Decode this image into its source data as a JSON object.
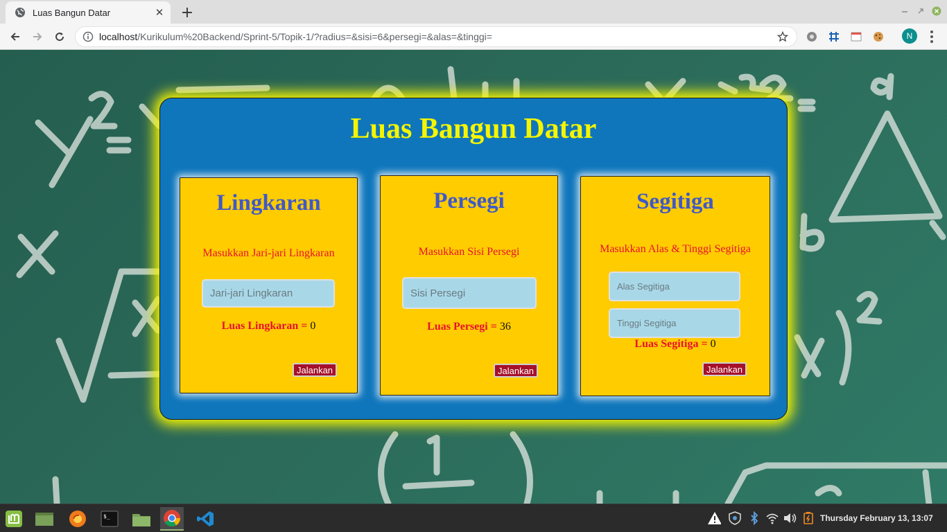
{
  "browser": {
    "tab_title": "Luas Bangun Datar",
    "tab_close": "✕",
    "new_tab": "+",
    "url_host": "localhost",
    "url_path": "/Kurikulum%20Backend/Sprint-5/Topik-1/?radius=&sisi=6&persegi=&alas=&tinggi=",
    "profile_initial": "N"
  },
  "page": {
    "title": "Luas Bangun Datar",
    "lingkaran": {
      "heading": "Lingkaran",
      "prompt": "Masukkan Jari-jari Lingkaran",
      "input_placeholder": "Jari-jari Lingkaran",
      "result_label": "Luas Lingkaran =",
      "result_value": "0",
      "button": "Jalankan"
    },
    "persegi": {
      "heading": "Persegi",
      "prompt": "Masukkan Sisi Persegi",
      "input_placeholder": "Sisi Persegi",
      "result_label": "Luas Persegi =",
      "result_value": "36",
      "button": "Jalankan"
    },
    "segitiga": {
      "heading": "Segitiga",
      "prompt": "Masukkan Alas & Tinggi Segitiga",
      "alas_placeholder": "Alas Segitiga",
      "tinggi_placeholder": "Tinggi Segitiga",
      "result_label": "Luas Segitiga =",
      "result_value": "0",
      "button": "Jalankan"
    }
  },
  "taskbar": {
    "clock": "Thursday February 13, 13:07",
    "apps": [
      "mint-menu-icon",
      "show-desktop-icon",
      "firefox-icon",
      "terminal-icon",
      "files-icon",
      "chrome-icon",
      "vscode-icon"
    ]
  },
  "colors": {
    "board": "#0f76bc",
    "board_glow": "#f5f500",
    "card": "#ffcc00",
    "heading": "#3f59c8",
    "prompt": "#e8112d",
    "button": "#a5102a",
    "input": "#a8d8e8"
  }
}
